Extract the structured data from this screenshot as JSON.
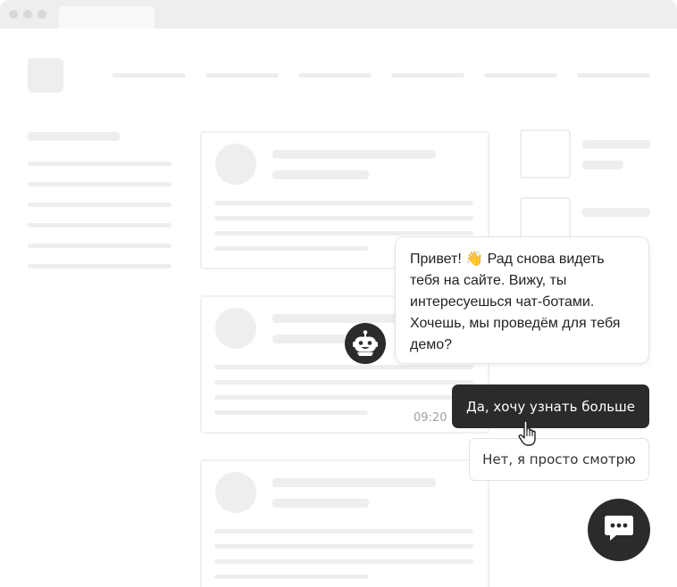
{
  "chat": {
    "bot_message_line1": "Привет! 👋 Рад снова видеть",
    "bot_message_line2": "тебя на сайте. Вижу, ты",
    "bot_message_line3": "интересуешься чат-ботами.",
    "bot_message_line4": "Хочешь, мы проведём для тебя",
    "bot_message_line5": "демо?",
    "timestamp": "09:20",
    "reply_yes": "Да, хочу узнать больше",
    "reply_no": "Нет, я просто смотрю"
  },
  "icons": {
    "bot_avatar": "robot-icon",
    "launcher": "chat-bubble-icon",
    "cursor": "hand-pointer-icon"
  },
  "colors": {
    "dark": "#2b2b2b",
    "placeholder": "#eeeeee",
    "border": "#e4e4e4"
  }
}
